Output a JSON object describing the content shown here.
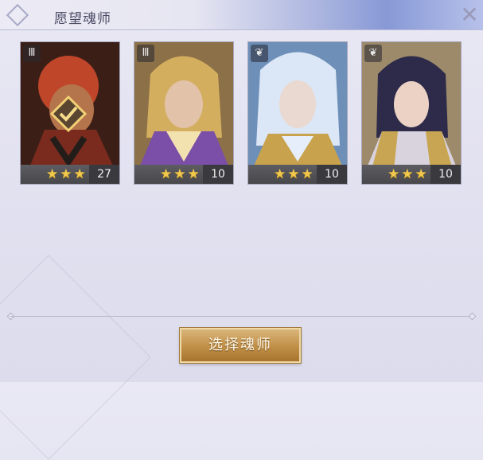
{
  "header": {
    "title": "愿望魂师",
    "close_label": "✕"
  },
  "cards": [
    {
      "job_icon": "tower-icon",
      "stars": "★★★",
      "level": "27",
      "selected": true,
      "palette": [
        "#7a2b1e",
        "#c0462a",
        "#3b1f17"
      ]
    },
    {
      "job_icon": "tower-icon",
      "stars": "★★★",
      "level": "10",
      "selected": false,
      "palette": [
        "#c9a35a",
        "#7b4fa7",
        "#f2e2b0"
      ]
    },
    {
      "job_icon": "wing-icon",
      "stars": "★★★",
      "level": "10",
      "selected": false,
      "palette": [
        "#a9c7ea",
        "#e6eefb",
        "#c8a24d"
      ]
    },
    {
      "job_icon": "wing-icon",
      "stars": "★★★",
      "level": "10",
      "selected": false,
      "palette": [
        "#2d2a4a",
        "#d9d3de",
        "#c7a552"
      ]
    }
  ],
  "button": {
    "label": "选择魂师"
  }
}
